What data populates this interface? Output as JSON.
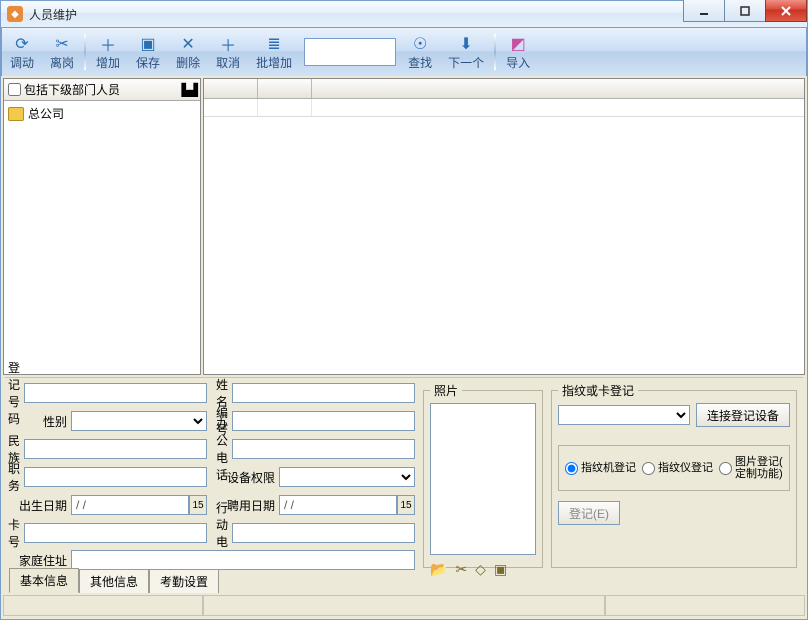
{
  "window": {
    "title": "人员维护"
  },
  "toolbar": {
    "transfer": "调动",
    "leave": "离岗",
    "add": "增加",
    "save": "保存",
    "delete": "删除",
    "cancel": "取消",
    "batch_add": "批增加",
    "search_value": "",
    "find": "查找",
    "next": "下一个",
    "import": "导入"
  },
  "left": {
    "include_sub_label": "包括下级部门人员",
    "tree_root": "总公司"
  },
  "form": {
    "reg_no": "登记号码",
    "name": "姓名",
    "gender": "性别",
    "emp_no": "编号",
    "ethnic": "民族",
    "office_phone": "办公电话",
    "position": "职务",
    "device_priv": "设备权限",
    "birth_date": "出生日期",
    "hire_date": "聘用日期",
    "date_placeholder": "    /    /",
    "card_no": "卡号",
    "mobile": "行动电话",
    "home_addr": "家庭住址"
  },
  "photo": {
    "legend": "照片"
  },
  "fp": {
    "legend": "指纹或卡登记",
    "connect_btn": "连接登记设备",
    "radio1": "指纹机登记",
    "radio2": "指纹仪登记",
    "radio3a": "图片登记(",
    "radio3b": "定制功能)",
    "register_btn": "登记(E)"
  },
  "tabs": {
    "t1": "基本信息",
    "t2": "其他信息",
    "t3": "考勤设置"
  },
  "icons": {
    "date_glyph": "15",
    "org": "⌂"
  }
}
